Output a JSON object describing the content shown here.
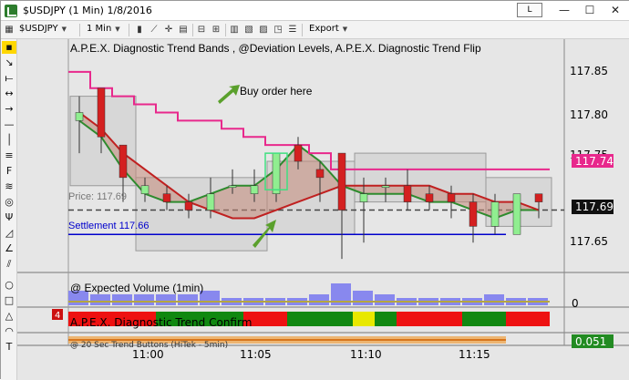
{
  "window": {
    "title": "$USDJPY (1 Min)  1/8/2016",
    "mode_button": "L",
    "minimize": "—",
    "maximize": "☐",
    "close": "✕"
  },
  "toolbar": {
    "symbol": "$USDJPY",
    "interval": "1 Min",
    "export": "Export"
  },
  "price_panel": {
    "title": "A.P.E.X. Diagnostic Trend Bands , @Deviation Levels, A.P.E.X. Diagnostic Trend Flip",
    "annotation": "Buy order here",
    "price_label": "Price: 117.69",
    "settlement_label": "Settlement 117.66",
    "axis_ticks": [
      "117.85",
      "117.80",
      "117.75",
      "117.65"
    ],
    "badge_magenta": "117.74",
    "badge_current": "117.69",
    "colors": {
      "magenta": "#e8288c",
      "badge_dark": "#111111",
      "up": "#90ee90",
      "down": "#d42020",
      "green_line": "#2e8b2e",
      "red_line": "#c02020",
      "settlement": "#0000cc"
    }
  },
  "volume_panel": {
    "title": "@ Expected Volume (1min)",
    "axis_tick": "0"
  },
  "confirm_panel": {
    "title": "A.P.E.X. Diagnostic Trend Confirm",
    "badge": "4"
  },
  "bottom_panel": {
    "title": "@ 20 Sec Trend Buttons (HiTek - 5min)",
    "badge": "0.051"
  },
  "time_axis": [
    "11:00",
    "11:05",
    "11:10",
    "11:15"
  ],
  "chart_data": {
    "type": "candlestick",
    "ylim": [
      117.62,
      117.88
    ],
    "candles": [
      {
        "o": 117.8,
        "h": 117.83,
        "l": 117.76,
        "c": 117.81
      },
      {
        "o": 117.84,
        "h": 117.84,
        "l": 117.76,
        "c": 117.78
      },
      {
        "o": 117.77,
        "h": 117.77,
        "l": 117.7,
        "c": 117.73
      },
      {
        "o": 117.71,
        "h": 117.73,
        "l": 117.7,
        "c": 117.72
      },
      {
        "o": 117.71,
        "h": 117.72,
        "l": 117.69,
        "c": 117.7
      },
      {
        "o": 117.7,
        "h": 117.71,
        "l": 117.68,
        "c": 117.69
      },
      {
        "o": 117.69,
        "h": 117.73,
        "l": 117.68,
        "c": 117.71
      },
      {
        "o": 117.72,
        "h": 117.74,
        "l": 117.71,
        "c": 117.72
      },
      {
        "o": 117.71,
        "h": 117.74,
        "l": 117.7,
        "c": 117.72
      },
      {
        "o": 117.71,
        "h": 117.76,
        "l": 117.7,
        "c": 117.76
      },
      {
        "o": 117.77,
        "h": 117.78,
        "l": 117.74,
        "c": 117.75
      },
      {
        "o": 117.74,
        "h": 117.75,
        "l": 117.7,
        "c": 117.73
      },
      {
        "o": 117.76,
        "h": 117.76,
        "l": 117.63,
        "c": 117.69
      },
      {
        "o": 117.7,
        "h": 117.73,
        "l": 117.65,
        "c": 117.71
      },
      {
        "o": 117.72,
        "h": 117.73,
        "l": 117.7,
        "c": 117.72
      },
      {
        "o": 117.72,
        "h": 117.74,
        "l": 117.69,
        "c": 117.7
      },
      {
        "o": 117.71,
        "h": 117.72,
        "l": 117.69,
        "c": 117.7
      },
      {
        "o": 117.71,
        "h": 117.72,
        "l": 117.68,
        "c": 117.7
      },
      {
        "o": 117.7,
        "h": 117.71,
        "l": 117.65,
        "c": 117.67
      },
      {
        "o": 117.67,
        "h": 117.71,
        "l": 117.66,
        "c": 117.7
      },
      {
        "o": 117.66,
        "h": 117.71,
        "l": 117.66,
        "c": 117.71
      },
      {
        "o": 117.71,
        "h": 117.71,
        "l": 117.68,
        "c": 117.7
      }
    ],
    "green_band": [
      117.8,
      117.78,
      117.74,
      117.71,
      117.7,
      117.7,
      117.71,
      117.72,
      117.72,
      117.74,
      117.77,
      117.75,
      117.72,
      117.71,
      117.71,
      117.71,
      117.7,
      117.7,
      117.69,
      117.68,
      117.69,
      117.69
    ],
    "red_band": [
      117.81,
      117.79,
      117.76,
      117.74,
      117.72,
      117.7,
      117.69,
      117.68,
      117.68,
      117.69,
      117.7,
      117.71,
      117.72,
      117.72,
      117.72,
      117.72,
      117.72,
      117.71,
      117.71,
      117.7,
      117.7,
      117.69
    ],
    "magenta_step": [
      117.86,
      117.84,
      117.83,
      117.82,
      117.81,
      117.8,
      117.8,
      117.79,
      117.78,
      117.77,
      117.77,
      117.76,
      117.74,
      117.74,
      117.74,
      117.74,
      117.74,
      117.74,
      117.74,
      117.74,
      117.74,
      117.74
    ],
    "current_price": 117.69,
    "settlement": 117.66,
    "volume": [
      4,
      3,
      3,
      3,
      3,
      3,
      4,
      2,
      2,
      2,
      2,
      3,
      6,
      4,
      3,
      2,
      2,
      2,
      2,
      3,
      2,
      2
    ],
    "expected_volume": [
      1,
      1,
      1,
      1,
      1,
      1,
      1,
      1,
      1,
      1,
      1,
      1,
      1,
      1,
      1,
      1,
      1,
      1,
      1,
      1,
      1,
      1
    ],
    "confirm": [
      "r",
      "r",
      "r",
      "r",
      "g",
      "g",
      "g",
      "g",
      "r",
      "r",
      "g",
      "g",
      "g",
      "y",
      "g",
      "r",
      "r",
      "r",
      "g",
      "g",
      "r",
      "r"
    ]
  }
}
